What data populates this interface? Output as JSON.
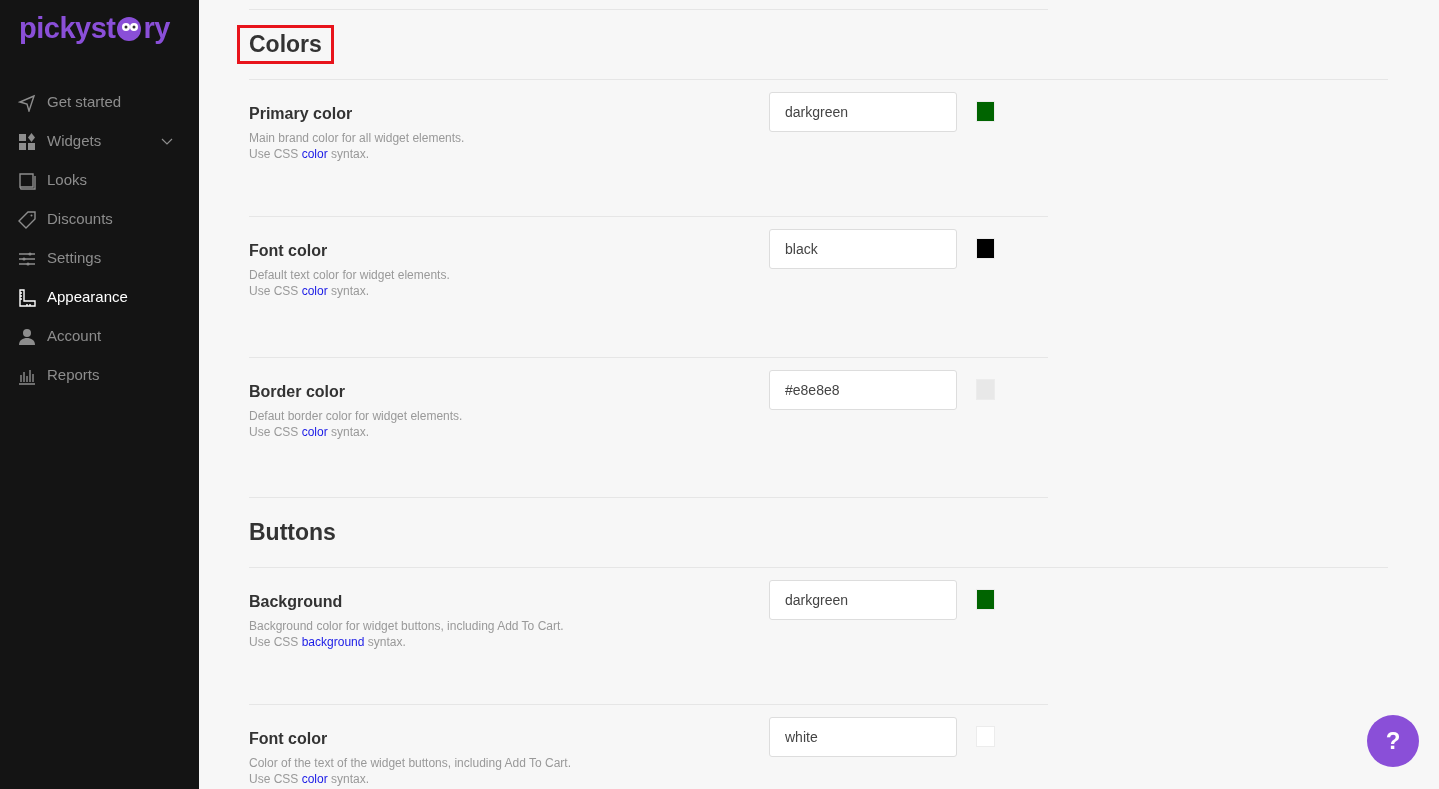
{
  "logo": {
    "before": "pickyst",
    "after": "ry"
  },
  "sidebar": {
    "items": [
      {
        "label": "Get started",
        "selected": false,
        "expandable": false
      },
      {
        "label": "Widgets",
        "selected": false,
        "expandable": true
      },
      {
        "label": "Looks",
        "selected": false,
        "expandable": false
      },
      {
        "label": "Discounts",
        "selected": false,
        "expandable": false
      },
      {
        "label": "Settings",
        "selected": false,
        "expandable": false
      },
      {
        "label": "Appearance",
        "selected": true,
        "expandable": false
      },
      {
        "label": "Account",
        "selected": false,
        "expandable": false
      },
      {
        "label": "Reports",
        "selected": false,
        "expandable": false
      }
    ]
  },
  "sections": [
    {
      "title": "Colors",
      "highlighted": true,
      "fields": [
        {
          "label": "Primary color",
          "description": "Main brand color for all widget elements.",
          "hint_before": "Use CSS ",
          "hint_link": "color",
          "hint_after": " syntax.",
          "value": "darkgreen",
          "color": "#006400"
        },
        {
          "label": "Font color",
          "description": "Default text color for widget elements.",
          "hint_before": "Use CSS ",
          "hint_link": "color",
          "hint_after": " syntax.",
          "value": "black",
          "color": "#000000"
        },
        {
          "label": "Border color",
          "description": "Defaut border color for widget elements.",
          "hint_before": "Use CSS ",
          "hint_link": "color",
          "hint_after": " syntax.",
          "value": "#e8e8e8",
          "color": "#e8e8e8"
        }
      ]
    },
    {
      "title": "Buttons",
      "highlighted": false,
      "fields": [
        {
          "label": "Background",
          "description": "Background color for widget buttons, including Add To Cart.",
          "hint_before": "Use CSS ",
          "hint_link": "background",
          "hint_after": " syntax.",
          "value": "darkgreen",
          "color": "#006400"
        },
        {
          "label": "Font color",
          "description": "Color of the text of the widget buttons, including Add To Cart.",
          "hint_before": "Use CSS ",
          "hint_link": "color",
          "hint_after": " syntax.",
          "value": "white",
          "color": "#ffffff"
        }
      ]
    }
  ],
  "help_button": {
    "label": "?"
  }
}
